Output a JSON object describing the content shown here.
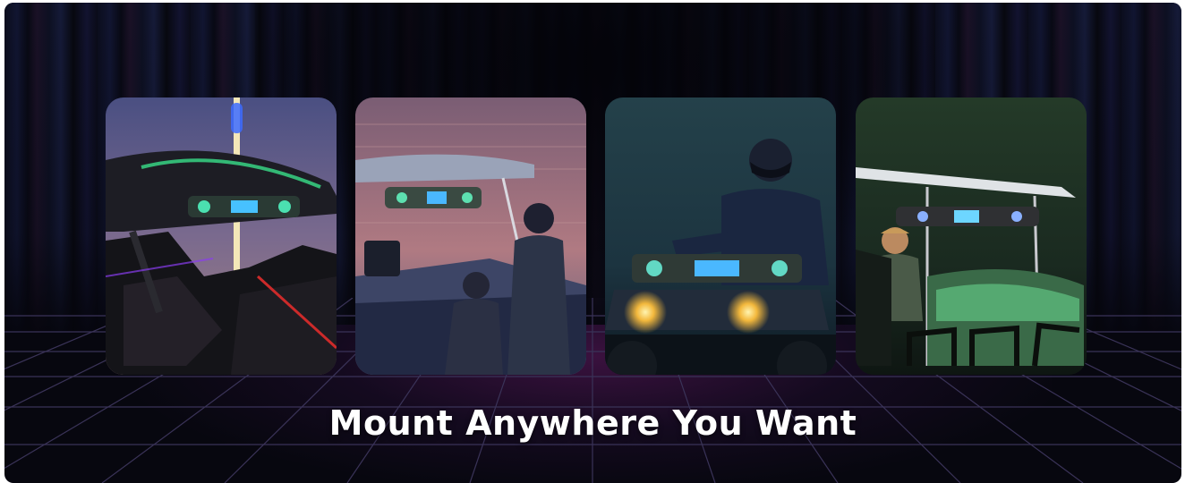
{
  "banner": {
    "headline": "Mount Anywhere You Want",
    "photos": [
      {
        "icon": "utv-soundbar-photo"
      },
      {
        "icon": "boat-soundbar-photo"
      },
      {
        "icon": "atv-soundbar-photo"
      },
      {
        "icon": "golf-cart-soundbar-photo"
      }
    ]
  },
  "colors": {
    "background": "#07070f",
    "grid_line": "#3a3358",
    "headline": "#ffffff"
  }
}
